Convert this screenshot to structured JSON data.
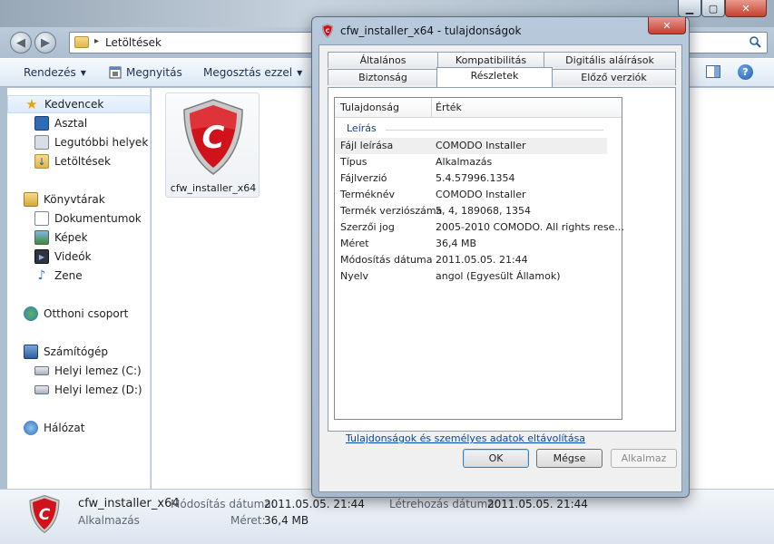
{
  "explorer": {
    "address": "Letöltések",
    "toolbar": {
      "organize": "Rendezés",
      "open": "Megnyitás",
      "share": "Megosztás ezzel"
    },
    "nav": [
      {
        "label": "Kedvencek",
        "icon": "star-icon",
        "selected": true
      },
      {
        "label": "Asztal",
        "icon": "desktop-icon"
      },
      {
        "label": "Legutóbbi helyek",
        "icon": "recent-places-icon"
      },
      {
        "label": "Letöltések",
        "icon": "downloads-folder-icon"
      },
      {
        "label": "Könyvtárak",
        "icon": "libraries-icon"
      },
      {
        "label": "Dokumentumok",
        "icon": "documents-icon"
      },
      {
        "label": "Képek",
        "icon": "pictures-icon"
      },
      {
        "label": "Videók",
        "icon": "videos-icon"
      },
      {
        "label": "Zene",
        "icon": "music-icon"
      },
      {
        "label": "Otthoni csoport",
        "icon": "homegroup-icon"
      },
      {
        "label": "Számítógép",
        "icon": "computer-icon"
      },
      {
        "label": "Helyi lemez (C:)",
        "icon": "drive-c-icon"
      },
      {
        "label": "Helyi lemez (D:)",
        "icon": "drive-d-icon"
      },
      {
        "label": "Hálózat",
        "icon": "network-icon"
      }
    ],
    "file": {
      "name": "cfw_installer_x64",
      "icon": "comodo-shield-icon"
    },
    "details": {
      "name": "cfw_installer_x64",
      "type": "Alkalmazás",
      "modified_label": "Módosítás dátuma:",
      "modified_value": "2011.05.05. 21:44",
      "created_label": "Létrehozás dátuma:",
      "created_value": "2011.05.05. 21:44",
      "size_label": "Méret:",
      "size_value": "36,4 MB"
    }
  },
  "dialog": {
    "title": "cfw_installer_x64 - tulajdonságok",
    "close_symbol": "✕",
    "tabs_row1": [
      "Általános",
      "Kompatibilitás",
      "Digitális aláírások"
    ],
    "tabs_row2": [
      "Biztonság",
      "Részletek",
      "Előző verziók"
    ],
    "active_tab": "Részletek",
    "list": {
      "col_property": "Tulajdonság",
      "col_value": "Érték",
      "group": "Leírás",
      "rows": [
        {
          "name": "Fájl leírása",
          "value": "COMODO Installer"
        },
        {
          "name": "Típus",
          "value": "Alkalmazás"
        },
        {
          "name": "Fájlverzió",
          "value": "5.4.57996.1354"
        },
        {
          "name": "Terméknév",
          "value": "COMODO Installer"
        },
        {
          "name": "Termék verziószáma",
          "value": "5, 4, 189068, 1354"
        },
        {
          "name": "Szerzői jog",
          "value": "2005-2010 COMODO. All rights rese..."
        },
        {
          "name": "Méret",
          "value": "36,4 MB"
        },
        {
          "name": "Módosítás dátuma",
          "value": "2011.05.05. 21:44"
        },
        {
          "name": "Nyelv",
          "value": "angol (Egyesült Államok)"
        }
      ]
    },
    "remove_link": "Tulajdonságok és személyes adatok eltávolítása",
    "buttons": {
      "ok": "OK",
      "cancel": "Mégse",
      "apply": "Alkalmaz"
    }
  },
  "colors": {
    "accent": "#1e5bb0",
    "comodo_red": "#d0121b"
  }
}
